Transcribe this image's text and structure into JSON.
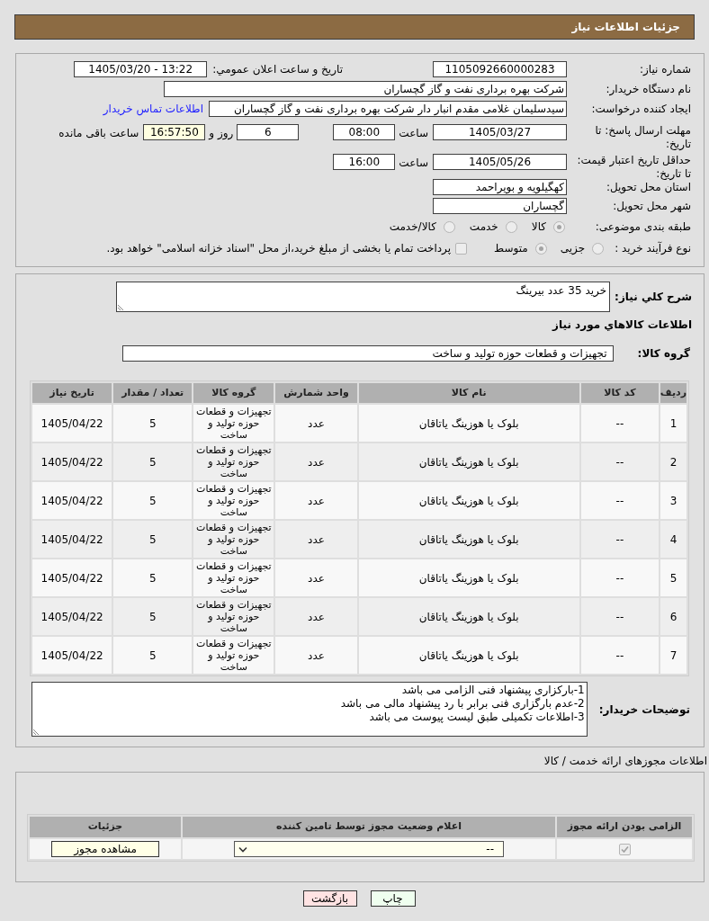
{
  "header": {
    "title": "جزئیات اطلاعات نیاز"
  },
  "summary": {
    "need_number": {
      "label": "شماره نیاز:",
      "value": "1105092660000283"
    },
    "announcement": {
      "label": "تاریخ و ساعت اعلان عمومي:",
      "value": "1405/03/20 - 13:22"
    },
    "buyer_org": {
      "label": "نام دستگاه خریدار:",
      "value": "شرکت بهره برداری نفت و گاز گچساران"
    },
    "requester": {
      "label": "ایجاد کننده درخواست:",
      "value": "سیدسلیمان غلامی مقدم انبار دار شرکت بهره برداری نفت و گاز گچساران",
      "contact_link": "اطلاعات تماس خریدار"
    },
    "reply_deadline": {
      "label": "مهلت ارسال پاسخ: تا تاریخ:",
      "date": "1405/03/27",
      "time_label": "ساعت",
      "time": "08:00",
      "days": "6",
      "days_label": "روز و",
      "remaining": "16:57:50",
      "remaining_label": "ساعت باقی مانده"
    },
    "price_validity": {
      "label": "حداقل تاریخ اعتبار قیمت: تا تاریخ:",
      "date": "1405/05/26",
      "time_label": "ساعت",
      "time": "16:00"
    },
    "province": {
      "label": "استان محل تحویل:",
      "value": "کهگیلویه و بویراحمد"
    },
    "city": {
      "label": "شهر محل تحویل:",
      "value": "گچساران"
    },
    "category": {
      "label": "طبقه بندی موضوعی:",
      "options": [
        {
          "label": "کالا",
          "selected": true
        },
        {
          "label": "خدمت",
          "selected": false
        },
        {
          "label": "کالا/خدمت",
          "selected": false
        }
      ]
    },
    "process": {
      "label": "نوع فرآیند خرید :",
      "options": [
        {
          "label": "جزیی",
          "selected": false
        },
        {
          "label": "متوسط",
          "selected": true
        }
      ],
      "treasury": {
        "label": "پرداخت تمام یا بخشی از مبلغ خرید،از محل \"اسناد خزانه اسلامی\" خواهد بود.",
        "checked": false
      }
    }
  },
  "goods": {
    "description": {
      "label": "شرح کلي نياز:",
      "value": "خرید 35 عدد بیرینگ"
    },
    "section_title": "اطلاعات کالاهاي مورد نياز",
    "group": {
      "label": "گروه کالا:",
      "value": "تجهیزات و قطعات حوزه تولید و ساخت"
    },
    "table": {
      "columns": [
        "ردیف",
        "کد کالا",
        "نام کالا",
        "واحد شمارش",
        "گروه کالا",
        "تعداد / مقدار",
        "تاریخ نیاز"
      ],
      "rows": [
        {
          "cells": [
            "1",
            "--",
            "بلوک یا هوزینگ یاتاقان",
            "عدد",
            "تجهیزات و قطعات حوزه تولید و ساخت",
            "5",
            "1405/04/22"
          ]
        },
        {
          "cells": [
            "2",
            "--",
            "بلوک یا هوزینگ یاتاقان",
            "عدد",
            "تجهیزات و قطعات حوزه تولید و ساخت",
            "5",
            "1405/04/22"
          ]
        },
        {
          "cells": [
            "3",
            "--",
            "بلوک یا هوزینگ یاتاقان",
            "عدد",
            "تجهیزات و قطعات حوزه تولید و ساخت",
            "5",
            "1405/04/22"
          ]
        },
        {
          "cells": [
            "4",
            "--",
            "بلوک یا هوزینگ یاتاقان",
            "عدد",
            "تجهیزات و قطعات حوزه تولید و ساخت",
            "5",
            "1405/04/22"
          ]
        },
        {
          "cells": [
            "5",
            "--",
            "بلوک یا هوزینگ یاتاقان",
            "عدد",
            "تجهیزات و قطعات حوزه تولید و ساخت",
            "5",
            "1405/04/22"
          ]
        },
        {
          "cells": [
            "6",
            "--",
            "بلوک یا هوزینگ یاتاقان",
            "عدد",
            "تجهیزات و قطعات حوزه تولید و ساخت",
            "5",
            "1405/04/22"
          ]
        },
        {
          "cells": [
            "7",
            "--",
            "بلوک یا هوزینگ یاتاقان",
            "عدد",
            "تجهیزات و قطعات حوزه تولید و ساخت",
            "5",
            "1405/04/22"
          ]
        }
      ]
    },
    "buyer_notes": {
      "label": "توضیحات خریدار:",
      "lines": [
        "1-بارکزاری پیشنهاد فنی الزامی می باشد",
        "2-عدم بارگزاری فنی برابر با رد پیشنهاد مالی می باشد",
        "3-اطلاعات تکمیلی طبق لیست پیوست می باشد"
      ]
    }
  },
  "licenses": {
    "title": "اطلاعات مجوزهای ارائه خدمت / کالا",
    "columns": [
      "الزامی بودن ارائه مجوز",
      "اعلام وضعیت مجوز توسط تامین کننده",
      "جزئیات"
    ],
    "rows": [
      {
        "required": true,
        "status": "--",
        "details_button": "مشاهده مجوز"
      }
    ]
  },
  "actions": [
    {
      "kind": "print",
      "label": "چاپ"
    },
    {
      "kind": "back",
      "label": "بازگشت"
    }
  ]
}
